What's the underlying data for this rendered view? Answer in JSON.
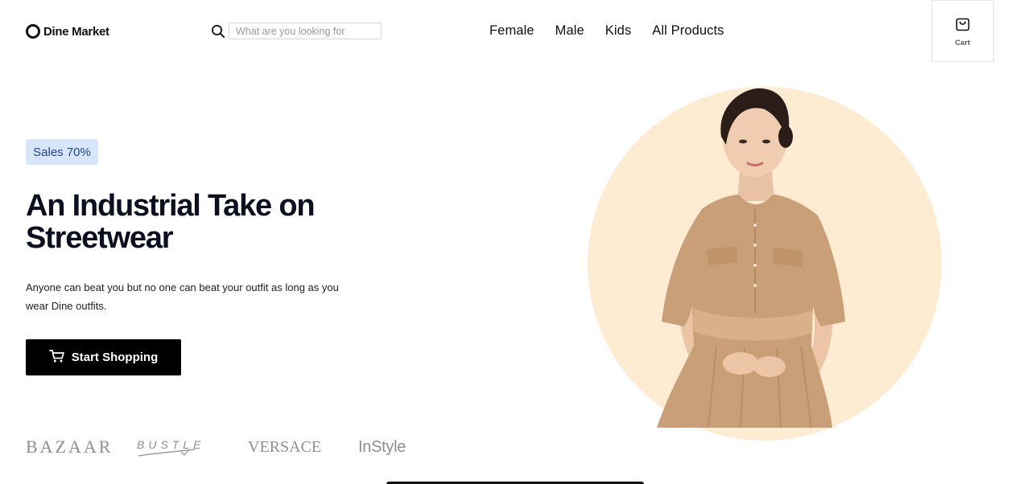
{
  "brand": {
    "name": "Dine Market"
  },
  "search": {
    "placeholder": "What are you looking for",
    "icon": "search-icon"
  },
  "nav": {
    "items": [
      {
        "label": "Female"
      },
      {
        "label": "Male"
      },
      {
        "label": "Kids"
      },
      {
        "label": "All Products"
      }
    ]
  },
  "cart": {
    "label": "Cart",
    "icon": "shopping-bag-icon"
  },
  "hero": {
    "badge": "Sales 70%",
    "headline_line1": "An Industrial Take on",
    "headline_line2": "Streetwear",
    "subtext": "Anyone can beat you but no one can beat your outfit as long as you wear Dine outfits.",
    "cta_label": "Start Shopping",
    "cta_icon": "cart-icon",
    "image": "woman in beige shirt dress",
    "circle_color": "#fdebd2"
  },
  "brands": [
    {
      "label": "BAZAAR"
    },
    {
      "label": "BUSTLE"
    },
    {
      "label": "VERSACE"
    },
    {
      "label": "InStyle"
    }
  ],
  "colors": {
    "badge_bg": "#d7e6fb",
    "badge_text": "#21458f",
    "cta_bg": "#000000",
    "accent_circle": "#fdebd2"
  }
}
